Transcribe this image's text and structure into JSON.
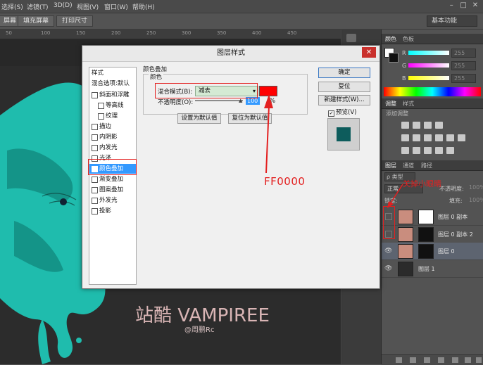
{
  "menubar": {
    "items": [
      "选择(S)",
      "滤镜(T)",
      "3D(D)",
      "视图(V)",
      "窗口(W)",
      "帮助(H)"
    ],
    "window_controls": [
      "–",
      "□",
      "✕"
    ]
  },
  "optionsbar": {
    "buttons": [
      "屏幕",
      "填充屏幕",
      "打印尺寸"
    ],
    "workspace": "基本功能"
  },
  "ruler": {
    "marks": [
      "50",
      "100",
      "150",
      "200",
      "250",
      "300",
      "350",
      "400",
      "450"
    ]
  },
  "canvas": {
    "watermark_title": "站酷 VAMPIREE",
    "watermark_author": "@周鹏Rc",
    "accent_color": "#1fc4b4"
  },
  "color_panel": {
    "tabs": [
      "颜色",
      "色板"
    ],
    "channels": [
      {
        "label": "R",
        "value": "255"
      },
      {
        "label": "G",
        "value": "255"
      },
      {
        "label": "B",
        "value": "255"
      }
    ]
  },
  "adjust_panel": {
    "tabs": [
      "调整",
      "样式"
    ],
    "subtitle": "添加调整"
  },
  "layers_panel": {
    "tabs": [
      "图层",
      "通道",
      "路径"
    ],
    "search": "ρ 类型",
    "blend_mode": "正常",
    "opacity_label": "不透明度:",
    "opacity_value": "100%",
    "lock_label": "锁定:",
    "fill_label": "填充:",
    "fill_value": "100%",
    "layers": [
      {
        "name": "图层 0 副本",
        "visible": false
      },
      {
        "name": "图层 0 副本 2",
        "visible": false
      },
      {
        "name": "图层 0",
        "visible": true
      },
      {
        "name": "图层 1",
        "visible": true
      }
    ],
    "eye_symbol": "👁"
  },
  "dialog": {
    "title": "图层样式",
    "close": "✕",
    "style_list_header": "样式",
    "blend_options": "混合选项:默认",
    "styles": [
      {
        "label": "斜面和浮雕",
        "checked": false,
        "indent": false
      },
      {
        "label": "等高线",
        "checked": false,
        "indent": true
      },
      {
        "label": "纹理",
        "checked": false,
        "indent": true
      },
      {
        "label": "描边",
        "checked": false,
        "indent": false
      },
      {
        "label": "内阴影",
        "checked": false,
        "indent": false
      },
      {
        "label": "内发光",
        "checked": false,
        "indent": false
      },
      {
        "label": "光泽",
        "checked": false,
        "indent": false
      },
      {
        "label": "颜色叠加",
        "checked": true,
        "indent": false,
        "active": true
      },
      {
        "label": "渐变叠加",
        "checked": false,
        "indent": false
      },
      {
        "label": "图案叠加",
        "checked": false,
        "indent": false
      },
      {
        "label": "外发光",
        "checked": false,
        "indent": false
      },
      {
        "label": "投影",
        "checked": false,
        "indent": false
      }
    ],
    "section_title": "颜色叠加",
    "group_title": "颜色",
    "blend_mode_label": "混合模式(B):",
    "blend_mode_value": "减去",
    "overlay_color": "#ff0000",
    "opacity_label": "不透明度(O):",
    "opacity_value": "100",
    "opacity_unit": "%",
    "set_default": "设置为默认值",
    "reset_default": "复位为默认值",
    "buttons": {
      "ok": "确定",
      "reset": "复位",
      "new_style": "新建样式(W)...",
      "preview": "预览(V)"
    },
    "preview_color": "#0d5c5c"
  },
  "annotations": {
    "hex": "FF0000",
    "eye": "关掉小眼睛",
    "color": "#e32020"
  }
}
